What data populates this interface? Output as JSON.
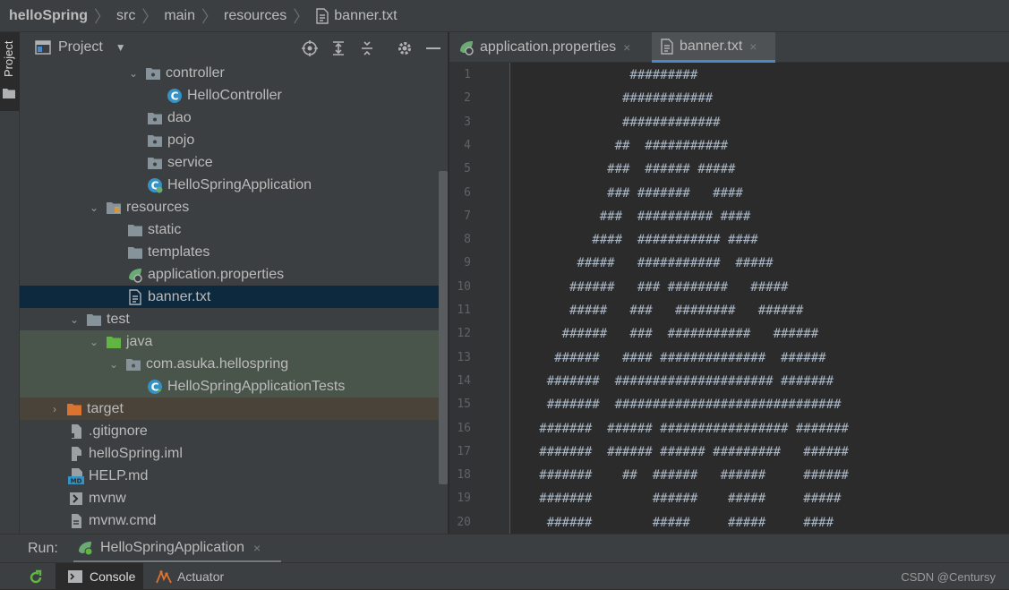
{
  "breadcrumb": {
    "items": [
      "helloSpring",
      "src",
      "main",
      "resources",
      "banner.txt"
    ]
  },
  "left_stripe": {
    "project_label": "Project"
  },
  "project_panel": {
    "title": "Project",
    "tree": [
      {
        "label": "controller",
        "icon": "package-folder-icon",
        "arrow": "expanded"
      },
      {
        "label": "HelloController",
        "icon": "java-class-icon",
        "arrow": "none"
      },
      {
        "label": "dao",
        "icon": "package-folder-icon",
        "arrow": "none"
      },
      {
        "label": "pojo",
        "icon": "package-folder-icon",
        "arrow": "none"
      },
      {
        "label": "service",
        "icon": "package-folder-icon",
        "arrow": "none"
      },
      {
        "label": "HelloSpringApplication",
        "icon": "spring-boot-class-icon",
        "arrow": "none"
      },
      {
        "label": "resources",
        "icon": "resources-folder-icon",
        "arrow": "expanded"
      },
      {
        "label": "static",
        "icon": "folder-icon",
        "arrow": "none"
      },
      {
        "label": "templates",
        "icon": "folder-icon",
        "arrow": "none"
      },
      {
        "label": "application.properties",
        "icon": "spring-properties-icon",
        "arrow": "none"
      },
      {
        "label": "banner.txt",
        "icon": "text-file-icon",
        "arrow": "none"
      },
      {
        "label": "test",
        "icon": "folder-icon",
        "arrow": "expanded"
      },
      {
        "label": "java",
        "icon": "test-source-folder-icon",
        "arrow": "expanded"
      },
      {
        "label": "com.asuka.hellospring",
        "icon": "package-folder-icon",
        "arrow": "expanded"
      },
      {
        "label": "HelloSpringApplicationTests",
        "icon": "test-class-icon",
        "arrow": "none"
      },
      {
        "label": "target",
        "icon": "excluded-folder-icon",
        "arrow": "collapsed"
      },
      {
        "label": ".gitignore",
        "icon": "gitignore-file-icon",
        "arrow": "none"
      },
      {
        "label": "helloSpring.iml",
        "icon": "iml-file-icon",
        "arrow": "none"
      },
      {
        "label": "HELP.md",
        "icon": "markdown-file-icon",
        "arrow": "none"
      },
      {
        "label": "mvnw",
        "icon": "shell-file-icon",
        "arrow": "none"
      },
      {
        "label": "mvnw.cmd",
        "icon": "cmd-file-icon",
        "arrow": "none"
      }
    ]
  },
  "editor": {
    "tabs": [
      {
        "label": "application.properties",
        "close": "×",
        "active": false
      },
      {
        "label": "banner.txt",
        "close": "×",
        "active": true
      }
    ],
    "line_numbers": [
      "1",
      "2",
      "3",
      "4",
      "5",
      "6",
      "7",
      "8",
      "9",
      "10",
      "11",
      "12",
      "13",
      "14",
      "15",
      "16",
      "17",
      "18",
      "19",
      "20"
    ],
    "lines": [
      "               #########",
      "              ############",
      "              #############",
      "             ##  ###########",
      "            ###  ###### #####",
      "            ### #######   ####",
      "           ###  ########## ####",
      "          ####  ########### ####",
      "        #####   ###########  #####",
      "       ######   ### ########   #####",
      "       #####   ###   ########   ######",
      "      ######   ###  ###########   ######",
      "     ######   #### ##############  ######",
      "    #######  ##################### #######",
      "    #######  ##############################",
      "   #######  ###### ################# #######",
      "   #######  ###### ###### #########   ######",
      "   #######    ##  ######   ######     ######",
      "   #######        ######    #####     #####",
      "    ######        #####     #####     ####"
    ]
  },
  "run_bar": {
    "label": "Run:",
    "config": "HelloSpringApplication",
    "close": "×"
  },
  "bottom_bar": {
    "tabs": [
      "Console",
      "Actuator"
    ],
    "watermark": "CSDN @Centursy"
  }
}
